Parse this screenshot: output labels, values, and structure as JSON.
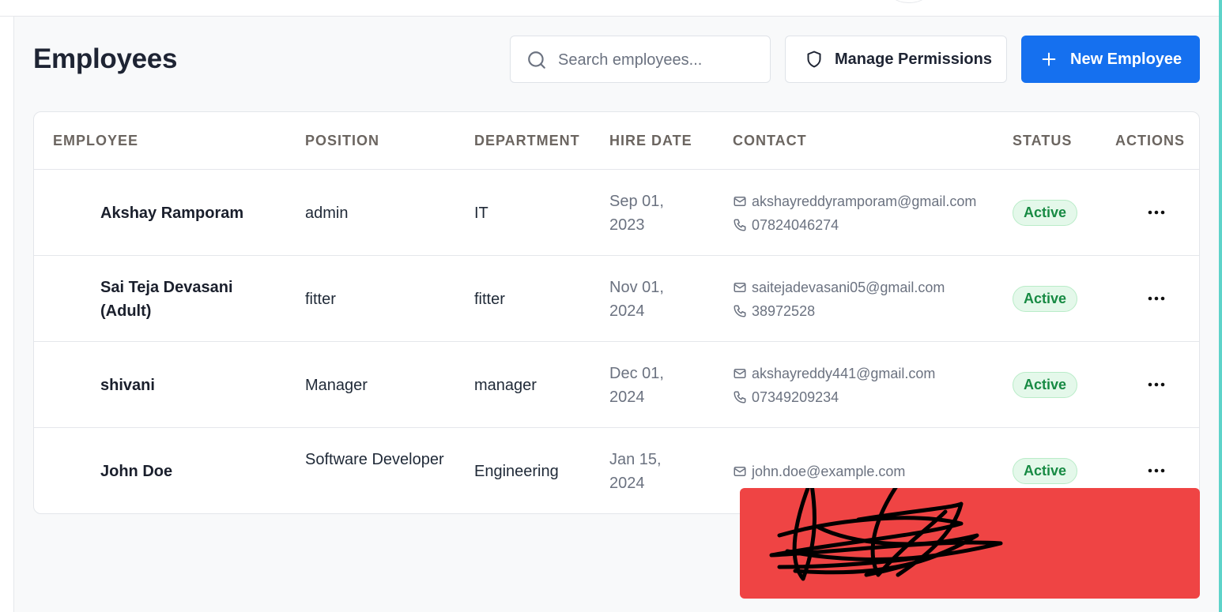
{
  "page": {
    "title": "Employees"
  },
  "toolbar": {
    "search_placeholder": "Search employees...",
    "manage_permissions_label": "Manage Permissions",
    "new_employee_label": "New Employee"
  },
  "table": {
    "columns": [
      "EMPLOYEE",
      "POSITION",
      "DEPARTMENT",
      "HIRE DATE",
      "CONTACT",
      "STATUS",
      "ACTIONS"
    ],
    "rows": [
      {
        "name": "Akshay Ramporam",
        "position": "admin",
        "department": "IT",
        "hire_date": "Sep 01, 2023",
        "email": "akshayreddyramporam@gmail.com",
        "phone": "07824046274",
        "status": "Active"
      },
      {
        "name": "Sai Teja Devasani (Adult)",
        "position": "fitter",
        "department": "fitter",
        "hire_date": "Nov 01, 2024",
        "email": "saitejadevasani05@gmail.com",
        "phone": "38972528",
        "status": "Active"
      },
      {
        "name": "shivani",
        "position": "Manager",
        "department": "manager",
        "hire_date": "Dec 01, 2024",
        "email": "akshayreddy441@gmail.com",
        "phone": "07349209234",
        "status": "Active"
      },
      {
        "name": "John Doe",
        "position": "Software Developer",
        "department": "Engineering",
        "hire_date": "Jan 15, 2024",
        "email": "john.doe@example.com",
        "phone": "",
        "status": "Active"
      }
    ]
  },
  "icons": {
    "search": "search-icon",
    "permissions": "shield-icon",
    "new": "plus-icon",
    "email": "mail-icon",
    "phone": "phone-icon",
    "row_actions": "more-horizontal-icon"
  },
  "colors": {
    "primary": "#1570ef",
    "status_active_bg": "#e4f8ea",
    "status_active_text": "#178a43",
    "toast_bg": "#ef4444"
  }
}
